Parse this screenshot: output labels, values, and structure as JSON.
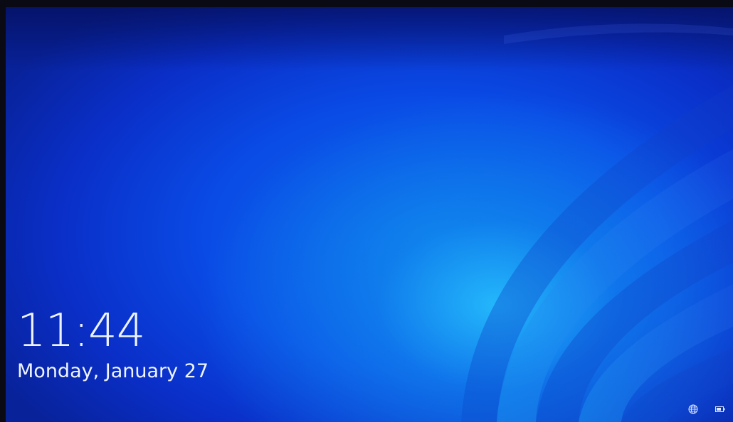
{
  "lock_screen": {
    "time": "11:44",
    "date": "Monday, January 27"
  },
  "system_tray": {
    "icons": [
      "network-globe-icon",
      "battery-icon"
    ]
  },
  "colors": {
    "background_dark": "#08229a",
    "background_mid": "#0a4be6",
    "background_glow": "#28c8ff",
    "text": "#eef4ff"
  }
}
